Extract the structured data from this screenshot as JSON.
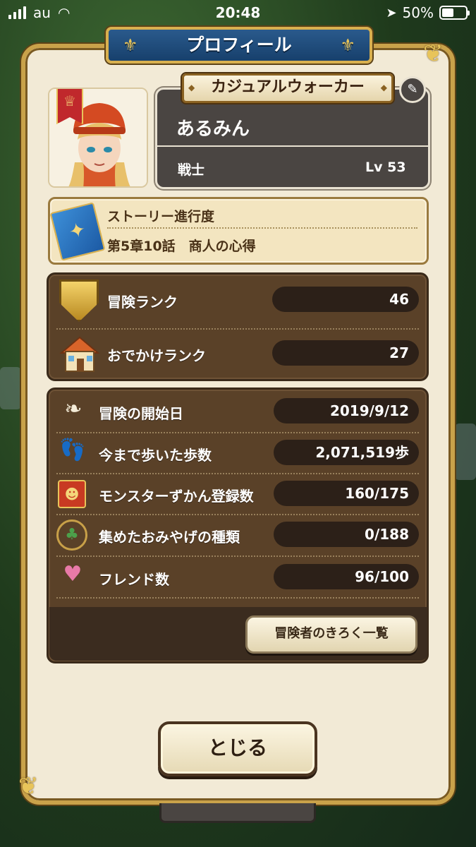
{
  "status_bar": {
    "carrier": "au",
    "time": "20:48",
    "battery_percent": "50%",
    "battery_level": 0.5
  },
  "header": {
    "title": "プロフィール"
  },
  "profile": {
    "title_ribbon": "カジュアルウォーカー",
    "name": "あるみん",
    "job": "戦士",
    "level": "Lv 53"
  },
  "story": {
    "label": "ストーリー進行度",
    "chapter": "第5章10話　商人の心得"
  },
  "ranks": [
    {
      "icon": "shield-icon",
      "label": "冒険ランク",
      "value": "46"
    },
    {
      "icon": "house-icon",
      "label": "おでかけランク",
      "value": "27"
    }
  ],
  "records": [
    {
      "icon": "wing-feather-icon",
      "label": "冒険の開始日",
      "value": "2019/9/12"
    },
    {
      "icon": "footprints-icon",
      "label": "今まで歩いた歩数",
      "value": "2,071,519歩"
    },
    {
      "icon": "monster-book-icon",
      "label": "モンスターずかん登録数",
      "value": "160/175"
    },
    {
      "icon": "japan-map-icon",
      "label": "集めたおみやげの種類",
      "value": "0/188"
    },
    {
      "icon": "handshake-icon",
      "label": "フレンド数",
      "value": "96/100"
    }
  ],
  "buttons": {
    "records_list": "冒険者のきろく一覧",
    "close": "とじる"
  }
}
